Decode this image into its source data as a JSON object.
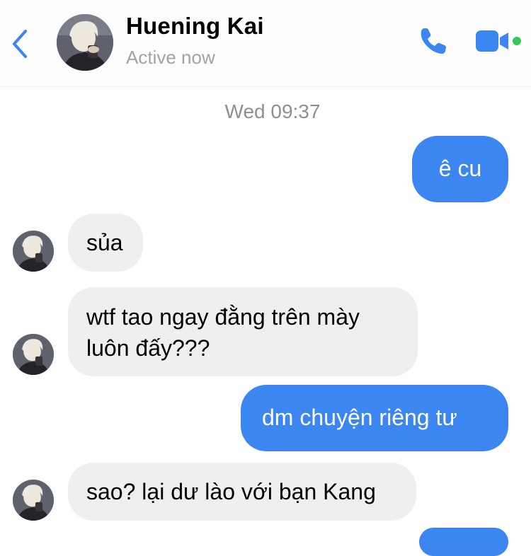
{
  "header": {
    "contact_name": "Huening Kai",
    "status": "Active now",
    "online_color": "#34c759",
    "accent_color": "#3b86f1"
  },
  "timestamp": "Wed 09:37",
  "messages": [
    {
      "direction": "outgoing",
      "text": "ê cu"
    },
    {
      "direction": "incoming",
      "text": "sủa"
    },
    {
      "direction": "incoming",
      "lines": [
        "wtf tao ngay đằng trên mày",
        "luôn đấy???"
      ]
    },
    {
      "direction": "outgoing",
      "text": "dm chuyện riêng tư"
    },
    {
      "direction": "incoming",
      "text": "sao? lại dư lào với bạn Kang"
    }
  ],
  "icons": [
    "back-chevron-icon",
    "contact-avatar",
    "phone-icon",
    "video-camera-icon"
  ]
}
